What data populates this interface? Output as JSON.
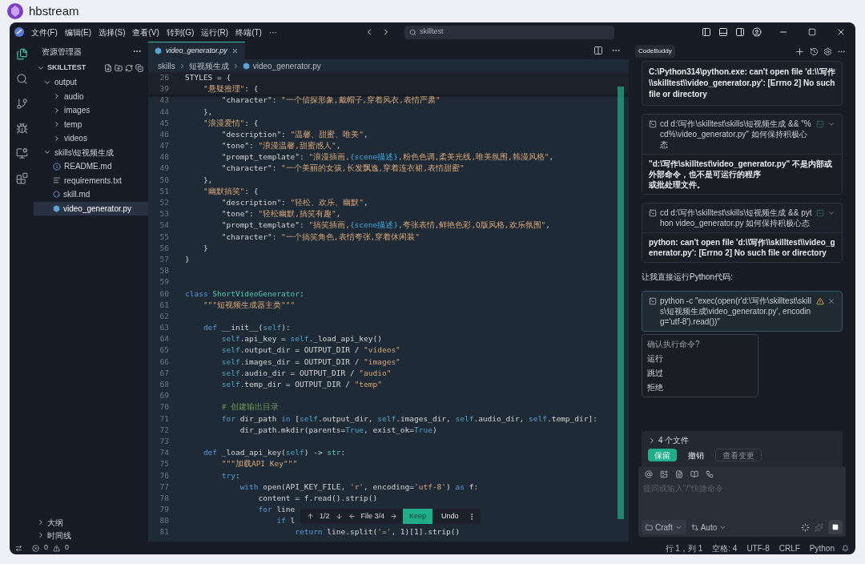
{
  "app": {
    "title": "hbstream"
  },
  "menu": [
    "文件(F)",
    "编辑(E)",
    "选择(S)",
    "查看(V)",
    "转到(G)",
    "运行(R)",
    "终端(T)",
    "···"
  ],
  "search": {
    "value": "skilltest"
  },
  "sidebar": {
    "title": "资源管理器",
    "root": "SKILLTEST",
    "tree": [
      {
        "label": "output",
        "kind": "folder",
        "expanded": true,
        "selected": false,
        "children": [
          {
            "label": "audio",
            "kind": "folder",
            "expanded": false,
            "selected": false
          },
          {
            "label": "images",
            "kind": "folder",
            "expanded": false,
            "selected": false
          },
          {
            "label": "temp",
            "kind": "folder",
            "expanded": false,
            "selected": false
          },
          {
            "label": "videos",
            "kind": "folder",
            "expanded": false,
            "selected": false
          }
        ]
      },
      {
        "label": "skills\\短视频生成",
        "kind": "folder",
        "expanded": true,
        "selected": false,
        "children": [
          {
            "label": "README.md",
            "kind": "info",
            "selected": false
          },
          {
            "label": "requirements.txt",
            "kind": "text",
            "selected": false
          },
          {
            "label": "skill.md",
            "kind": "markdown",
            "selected": false
          },
          {
            "label": "video_generator.py",
            "kind": "python",
            "selected": true
          }
        ]
      }
    ],
    "panels": [
      {
        "label": "大纲",
        "expanded": false
      },
      {
        "label": "时间线",
        "expanded": false
      }
    ]
  },
  "editor": {
    "tabs": [
      {
        "label": "video_generator.py",
        "selected": true
      }
    ],
    "breadcrumb": [
      "skills",
      "短视频生成",
      "video_generator.py"
    ],
    "sticky": [
      {
        "n": "26",
        "seg": [
          {
            "kind": "plain",
            "text": "STYLES = {"
          }
        ]
      },
      {
        "n": "39",
        "seg": [
          {
            "kind": "string",
            "text": "    \"悬疑推理\""
          },
          {
            "kind": "plain",
            "text": ": {"
          }
        ]
      }
    ],
    "lines": [
      {
        "n": "43",
        "seg": [
          {
            "kind": "plain",
            "text": "        \"character\": "
          },
          {
            "kind": "string",
            "text": "\"一个侦探形象,戴帽子,穿着风衣,表情严肃\""
          }
        ]
      },
      {
        "n": "44",
        "seg": [
          {
            "kind": "plain",
            "text": "    },"
          }
        ]
      },
      {
        "n": "45",
        "seg": [
          {
            "kind": "string",
            "text": "    \"浪漫爱情\""
          },
          {
            "kind": "plain",
            "text": ": {"
          }
        ]
      },
      {
        "n": "46",
        "seg": [
          {
            "kind": "plain",
            "text": "        \"description\": "
          },
          {
            "kind": "string",
            "text": "\"温馨、甜蜜、唯美\""
          },
          {
            "kind": "plain",
            "text": ","
          }
        ]
      },
      {
        "n": "47",
        "seg": [
          {
            "kind": "plain",
            "text": "        \"tone\": "
          },
          {
            "kind": "string",
            "text": "\"浪漫温馨,甜蜜感人\""
          },
          {
            "kind": "plain",
            "text": ","
          }
        ]
      },
      {
        "n": "48",
        "seg": [
          {
            "kind": "plain",
            "text": "        \"prompt_template\": "
          },
          {
            "kind": "string",
            "text": "\"浪漫插画,"
          },
          {
            "kind": "interp",
            "text": "{scene描述}"
          },
          {
            "kind": "string",
            "text": ",粉色色调,柔美光线,唯美氛围,韩漫风格\""
          },
          {
            "kind": "plain",
            "text": ","
          }
        ]
      },
      {
        "n": "49",
        "seg": [
          {
            "kind": "plain",
            "text": "        \"character\": "
          },
          {
            "kind": "string",
            "text": "\"一个美丽的女孩,长发飘逸,穿着连衣裙,表情甜蜜\""
          }
        ]
      },
      {
        "n": "50",
        "seg": [
          {
            "kind": "plain",
            "text": "    },"
          }
        ]
      },
      {
        "n": "51",
        "seg": [
          {
            "kind": "string",
            "text": "    \"幽默搞笑\""
          },
          {
            "kind": "plain",
            "text": ": {"
          }
        ]
      },
      {
        "n": "52",
        "seg": [
          {
            "kind": "plain",
            "text": "        \"description\": "
          },
          {
            "kind": "string",
            "text": "\"轻松、欢乐、幽默\""
          },
          {
            "kind": "plain",
            "text": ","
          }
        ]
      },
      {
        "n": "53",
        "seg": [
          {
            "kind": "plain",
            "text": "        \"tone\": "
          },
          {
            "kind": "string",
            "text": "\"轻松幽默,搞笑有趣\""
          },
          {
            "kind": "plain",
            "text": ","
          }
        ]
      },
      {
        "n": "54",
        "seg": [
          {
            "kind": "plain",
            "text": "        \"prompt_template\": "
          },
          {
            "kind": "string",
            "text": "\"搞笑插画,"
          },
          {
            "kind": "interp",
            "text": "{scene描述}"
          },
          {
            "kind": "string",
            "text": ",夸张表情,鲜艳色彩,Q版风格,欢乐氛围\""
          },
          {
            "kind": "plain",
            "text": ","
          }
        ]
      },
      {
        "n": "55",
        "seg": [
          {
            "kind": "plain",
            "text": "        \"character\": "
          },
          {
            "kind": "string",
            "text": "\"一个搞笑角色,表情夸张,穿着休闲装\""
          }
        ]
      },
      {
        "n": "56",
        "seg": [
          {
            "kind": "plain",
            "text": "    }"
          }
        ]
      },
      {
        "n": "57",
        "seg": [
          {
            "kind": "plain",
            "text": "}"
          }
        ]
      },
      {
        "n": "58"
      },
      {
        "n": "59"
      },
      {
        "n": "60",
        "seg": [
          {
            "kind": "keyword",
            "text": "class "
          },
          {
            "kind": "type",
            "text": "ShortVideoGenerator"
          },
          {
            "kind": "plain",
            "text": ":"
          }
        ]
      },
      {
        "n": "61",
        "seg": [
          {
            "kind": "string",
            "text": "    \"\"\"短视频生成器主类\"\"\""
          }
        ]
      },
      {
        "n": "62"
      },
      {
        "n": "63",
        "seg": [
          {
            "kind": "keyword",
            "text": "    def "
          },
          {
            "kind": "plain",
            "text": "__init__("
          },
          {
            "kind": "self",
            "text": "self"
          },
          {
            "kind": "plain",
            "text": "):"
          }
        ]
      },
      {
        "n": "64",
        "seg": [
          {
            "kind": "self",
            "text": "        self"
          },
          {
            "kind": "plain",
            "text": ".api_key = "
          },
          {
            "kind": "self",
            "text": "self"
          },
          {
            "kind": "plain",
            "text": "._load_api_key()"
          }
        ]
      },
      {
        "n": "65",
        "seg": [
          {
            "kind": "self",
            "text": "        self"
          },
          {
            "kind": "plain",
            "text": ".output_dir = OUTPUT_DIR / "
          },
          {
            "kind": "string",
            "text": "\"videos\""
          }
        ]
      },
      {
        "n": "66",
        "seg": [
          {
            "kind": "self",
            "text": "        self"
          },
          {
            "kind": "plain",
            "text": ".images_dir = OUTPUT_DIR / "
          },
          {
            "kind": "string",
            "text": "\"images\""
          }
        ]
      },
      {
        "n": "67",
        "seg": [
          {
            "kind": "self",
            "text": "        self"
          },
          {
            "kind": "plain",
            "text": ".audio_dir = OUTPUT_DIR / "
          },
          {
            "kind": "string",
            "text": "\"audio\""
          }
        ]
      },
      {
        "n": "68",
        "seg": [
          {
            "kind": "self",
            "text": "        self"
          },
          {
            "kind": "plain",
            "text": ".temp_dir = OUTPUT_DIR / "
          },
          {
            "kind": "string",
            "text": "\"temp\""
          }
        ]
      },
      {
        "n": "69"
      },
      {
        "n": "70",
        "seg": [
          {
            "kind": "comment",
            "text": "        # 创建输出目录"
          }
        ]
      },
      {
        "n": "71",
        "seg": [
          {
            "kind": "keyword",
            "text": "        for "
          },
          {
            "kind": "plain",
            "text": "dir_path "
          },
          {
            "kind": "keyword",
            "text": "in "
          },
          {
            "kind": "plain",
            "text": "["
          },
          {
            "kind": "self",
            "text": "self"
          },
          {
            "kind": "plain",
            "text": ".output_dir, "
          },
          {
            "kind": "self",
            "text": "self"
          },
          {
            "kind": "plain",
            "text": ".images_dir, "
          },
          {
            "kind": "self",
            "text": "self"
          },
          {
            "kind": "plain",
            "text": ".audio_dir, "
          },
          {
            "kind": "self",
            "text": "self"
          },
          {
            "kind": "plain",
            "text": ".temp_dir]:"
          }
        ]
      },
      {
        "n": "72",
        "seg": [
          {
            "kind": "plain",
            "text": "            dir_path.mkdir(parents="
          },
          {
            "kind": "self",
            "text": "True"
          },
          {
            "kind": "plain",
            "text": ", exist_ok="
          },
          {
            "kind": "self",
            "text": "True"
          },
          {
            "kind": "plain",
            "text": ")"
          }
        ]
      },
      {
        "n": "73"
      },
      {
        "n": "74",
        "seg": [
          {
            "kind": "keyword",
            "text": "    def "
          },
          {
            "kind": "plain",
            "text": "_load_api_key("
          },
          {
            "kind": "self",
            "text": "self"
          },
          {
            "kind": "plain",
            "text": ") -> "
          },
          {
            "kind": "type",
            "text": "str"
          },
          {
            "kind": "plain",
            "text": ":"
          }
        ]
      },
      {
        "n": "75",
        "seg": [
          {
            "kind": "string",
            "text": "        \"\"\"加载API Key\"\"\""
          }
        ]
      },
      {
        "n": "76",
        "seg": [
          {
            "kind": "keyword",
            "text": "        try"
          },
          {
            "kind": "plain",
            "text": ":"
          }
        ]
      },
      {
        "n": "77",
        "seg": [
          {
            "kind": "keyword",
            "text": "            with "
          },
          {
            "kind": "plain",
            "text": "open(API_KEY_FILE, "
          },
          {
            "kind": "string",
            "text": "'r'"
          },
          {
            "kind": "plain",
            "text": ", encoding="
          },
          {
            "kind": "string",
            "text": "'utf-8'"
          },
          {
            "kind": "plain",
            "text": ") "
          },
          {
            "kind": "keyword",
            "text": "as "
          },
          {
            "kind": "plain",
            "text": "f:"
          }
        ]
      },
      {
        "n": "78",
        "seg": [
          {
            "kind": "plain",
            "text": "                content = f.read().strip()"
          }
        ]
      },
      {
        "n": "79",
        "seg": [
          {
            "kind": "keyword",
            "text": "                for "
          },
          {
            "kind": "plain",
            "text": "line"
          }
        ]
      },
      {
        "n": "80",
        "seg": [
          {
            "kind": "keyword",
            "text": "                    if "
          },
          {
            "kind": "plain",
            "text": "l"
          }
        ]
      },
      {
        "n": "81",
        "seg": [
          {
            "kind": "keyword",
            "text": "                        return "
          },
          {
            "kind": "plain",
            "text": "line.split("
          },
          {
            "kind": "string",
            "text": "'='"
          },
          {
            "kind": "plain",
            "text": ", 1)[1].strip()"
          }
        ]
      }
    ],
    "diff_bar": {
      "hunk": "1/2",
      "file": "File 3/4",
      "keep": "Keep",
      "undo": "Undo"
    }
  },
  "assistant": {
    "tabs": [
      {
        "label": "CodeBuddy",
        "selected": true
      }
    ],
    "messages": [
      {
        "kind": "output",
        "output": [
          "C:\\Python314\\python.exe: can't open file 'd:\\\\写作\\\\skilltest\\\\video_generator.py': [Errno 2] No such file or directory"
        ]
      },
      {
        "kind": "terminal",
        "command": "cd d:\\写作\\skilltest\\skills\\短视频生成 && \"%cd%\\video_generator.py\" 如何保持积极心态",
        "output": [
          "\"d:\\写作\\skilltest\\video_generator.py\" 不是内部或外部命令，也不是可运行的程序",
          "或批处理文件。"
        ]
      },
      {
        "kind": "terminal",
        "command": "cd d:\\写作\\skilltest\\skills\\短视频生成 && python video_generator.py 如何保持积极心态",
        "output": [
          "python: can't open file 'd:\\\\写作\\\\skilltest\\\\video_generator.py': [Errno 2] No such file or directory"
        ]
      },
      {
        "kind": "text",
        "text": "让我直接运行Python代码:"
      },
      {
        "kind": "pending",
        "command": "python -c \"exec(open(r'd:\\写作\\skilltest\\skills\\短视频生成\\video_generator.py', encoding='utf-8').read())\""
      }
    ],
    "confirm": {
      "title": "确认执行命令?",
      "options": [
        "运行",
        "跳过",
        "拒绝"
      ]
    },
    "changes": {
      "label": "4 个文件",
      "expanded": false,
      "buttons": [
        {
          "label": "保留",
          "kind": "primary"
        },
        {
          "label": "撤销",
          "kind": "plain"
        },
        {
          "label": "查看变更",
          "kind": "outline"
        }
      ]
    },
    "input": {
      "placeholder": "提问或输入\"/\"快捷命令",
      "mode": "Craft",
      "model": "Auto"
    }
  },
  "status_bar": {
    "errors": "0",
    "warnings": "0",
    "right": [
      "行 1，列 1",
      "空格: 4",
      "UTF-8",
      "CRLF",
      "Python"
    ]
  }
}
